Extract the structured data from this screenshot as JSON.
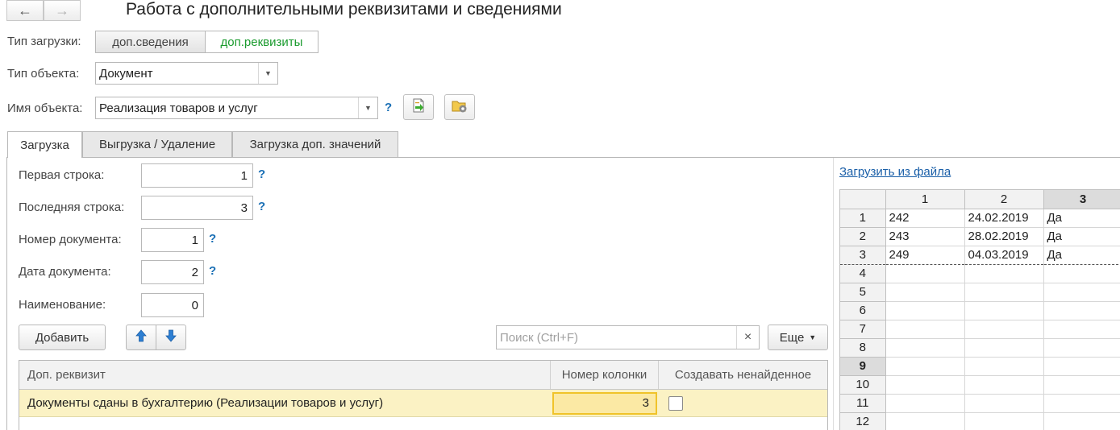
{
  "header": {
    "title": "Работа с дополнительными реквизитами и сведениями",
    "back_icon": "arrow-left-icon",
    "forward_icon": "arrow-right-icon"
  },
  "load_type": {
    "label": "Тип загрузки:",
    "options": [
      "доп.сведения",
      "доп.реквизиты"
    ],
    "selected": "доп.реквизиты",
    "accent_color": "#1a9b2e"
  },
  "object_type": {
    "label": "Тип объекта:",
    "value": "Документ"
  },
  "object_name": {
    "label": "Имя объекта:",
    "value": "Реализация товаров и услуг",
    "help": "?",
    "button1_icon": "document-arrow-icon",
    "button2_icon": "folder-gear-icon"
  },
  "tabs": [
    {
      "label": "Загрузка",
      "active": true
    },
    {
      "label": "Выгрузка / Удаление",
      "active": false
    },
    {
      "label": "Загрузка доп. значений",
      "active": false
    }
  ],
  "form": {
    "first_row": {
      "label": "Первая строка:",
      "value": "1",
      "help": "?"
    },
    "last_row": {
      "label": "Последняя строка:",
      "value": "3",
      "help": "?"
    },
    "doc_number": {
      "label": "Номер документа:",
      "value": "1",
      "help": "?"
    },
    "doc_date": {
      "label": "Дата документа:",
      "value": "2",
      "help": "?"
    },
    "name": {
      "label": "Наименование:",
      "value": "0"
    }
  },
  "toolbar": {
    "add_label": "Добавить",
    "up_icon": "arrow-up-icon",
    "down_icon": "arrow-down-icon",
    "search_placeholder": "Поиск (Ctrl+F)",
    "clear_label": "×",
    "more_label": "Еще"
  },
  "table": {
    "columns": [
      "Доп. реквизит",
      "Номер колонки",
      "Создавать ненайденное"
    ],
    "rows": [
      {
        "attr": "Документы сданы в бухгалтерию (Реализации товаров и услуг)",
        "column": "3",
        "create": false
      }
    ],
    "highlight_color": "#fbf2c4"
  },
  "sheet": {
    "load_link": "Загрузить из файла",
    "col_headers": [
      "1",
      "2",
      "3"
    ],
    "selected_col": "3",
    "row_numbers": [
      "1",
      "2",
      "3",
      "4",
      "5",
      "6",
      "7",
      "8",
      "9",
      "10",
      "11",
      "12"
    ],
    "selected_row": "9",
    "cells": [
      [
        "242",
        "24.02.2019",
        "Да"
      ],
      [
        "243",
        "28.02.2019",
        "Да"
      ],
      [
        "249",
        "04.03.2019",
        "Да"
      ]
    ]
  }
}
